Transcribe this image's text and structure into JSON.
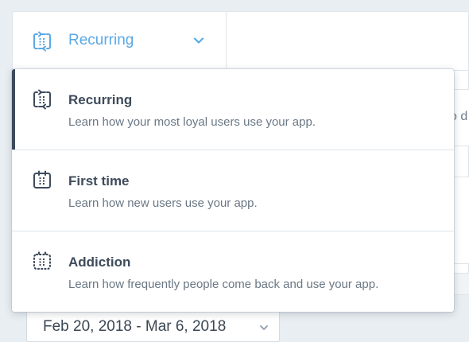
{
  "colors": {
    "accent": "#5aa9e6",
    "text_dark": "#3e4b5b",
    "text_muted": "#6a7784",
    "active_bar": "#3e4b5b"
  },
  "selector": {
    "label": "Recurring",
    "icon": "recurring-calendar-icon"
  },
  "background": {
    "peek_text": "o d"
  },
  "menu": {
    "items": [
      {
        "title": "Recurring",
        "description": "Learn how your most loyal users use your app.",
        "icon": "recurring-calendar-icon",
        "active": true
      },
      {
        "title": "First time",
        "description": "Learn how new users use your app.",
        "icon": "calendar-icon",
        "active": false
      },
      {
        "title": "Addiction",
        "description": "Learn how frequently people come back and use your app.",
        "icon": "dotted-calendar-icon",
        "active": false
      }
    ]
  },
  "date_range": {
    "value": "Feb 20, 2018 - Mar 6, 2018"
  }
}
